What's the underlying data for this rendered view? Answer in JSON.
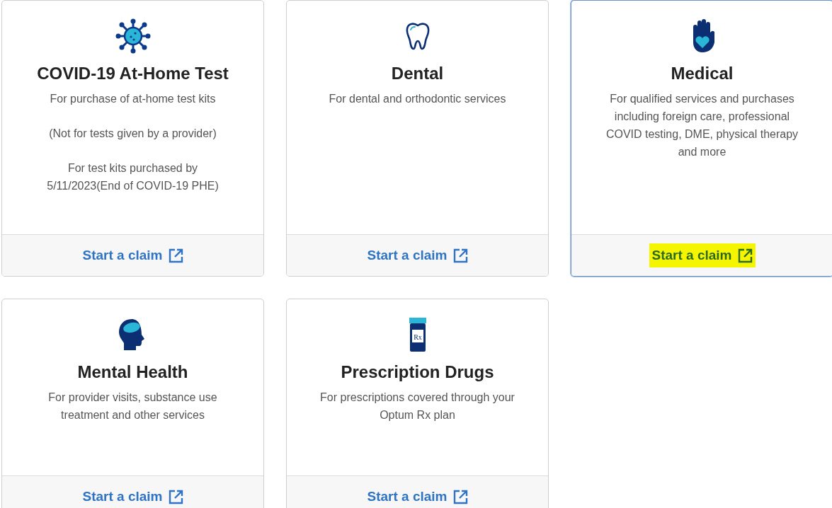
{
  "cards": [
    {
      "title": "COVID-19 At-Home Test",
      "paragraphs": [
        "For purchase of at-home test kits",
        "(Not for tests given by a provider)",
        "For test kits purchased by 5/11/2023(End of COVID-19 PHE)"
      ],
      "link": "Start a claim",
      "selected": false
    },
    {
      "title": "Dental",
      "paragraphs": [
        "For dental and orthodontic services"
      ],
      "link": "Start a claim",
      "selected": false
    },
    {
      "title": "Medical",
      "paragraphs": [
        "For qualified services and purchases including foreign care, professional COVID testing, DME, physical therapy and more"
      ],
      "link": "Start a claim",
      "selected": true
    },
    {
      "title": "Mental Health",
      "paragraphs": [
        "For provider visits, substance use treatment and other services"
      ],
      "link": "Start a claim",
      "selected": false
    },
    {
      "icon_text": "Rx",
      "title": "Prescription Drugs",
      "paragraphs": [
        "For prescriptions covered through your Optum Rx plan"
      ],
      "link": "Start a claim",
      "selected": false
    }
  ]
}
